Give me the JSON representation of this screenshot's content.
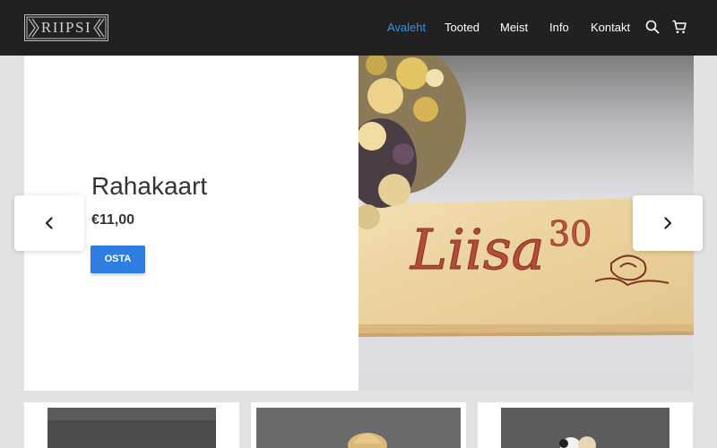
{
  "header": {
    "logo_text": "RIIPSI",
    "nav": [
      {
        "label": "Avaleht",
        "active": true
      },
      {
        "label": "Tooted",
        "active": false
      },
      {
        "label": "Meist",
        "active": false
      },
      {
        "label": "Info",
        "active": false
      },
      {
        "label": "Kontakt",
        "active": false
      }
    ],
    "icons": [
      "search-icon",
      "cart-icon"
    ]
  },
  "slider": {
    "title": "Rahakaart",
    "price": "€11,00",
    "button_label": "OSTA",
    "image": {
      "engraved_name": "Liisa",
      "engraved_number": "30"
    },
    "prev_icon": "chevron-left-icon",
    "next_icon": "chevron-right-icon"
  },
  "products": [
    {
      "name": "product-card-1"
    },
    {
      "name": "product-card-2"
    },
    {
      "name": "product-card-3"
    }
  ],
  "colors": {
    "header_bg": "#212121",
    "active_nav": "#3d8fe0",
    "button": "#2e7de1",
    "page_bg": "#e2e2e2"
  }
}
